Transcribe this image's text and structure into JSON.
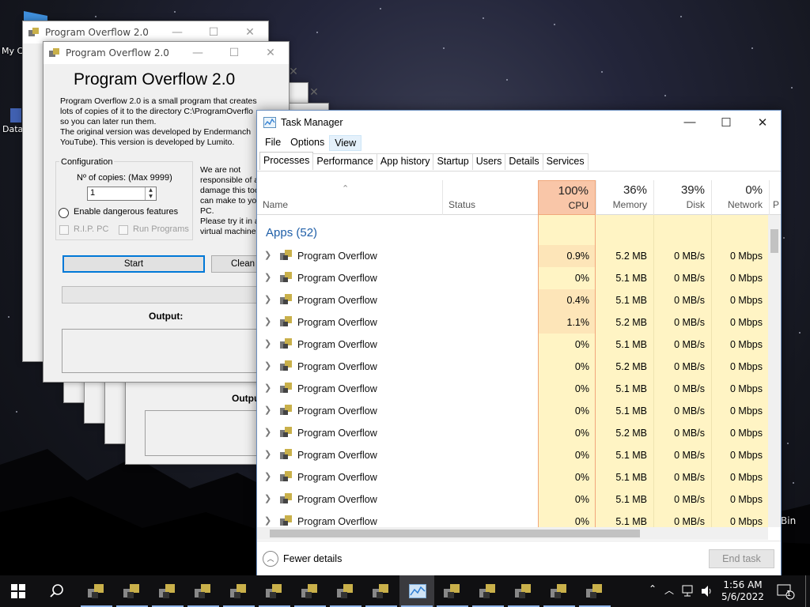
{
  "desktop": {
    "icons": [
      {
        "label": "My C"
      },
      {
        "label": "Data"
      },
      {
        "label": "Bin"
      }
    ]
  },
  "program_window": {
    "title_bar": "Program Overflow 2.0",
    "heading": "Program Overflow 2.0",
    "description": "Program Overflow 2.0 is a small program that creates lots of copies of it to the directory C:\\ProgramOverflo\nso you can later run them.\nThe original version was developed by Endermanch\nYouTube). This version is developed by Lumito.",
    "configuration_label": "Configuration",
    "copies_label": "Nº of copies: (Max 9999)",
    "copies_value": "1",
    "dangerous_label": "Enable dangerous features",
    "rip_pc_label": "R.I.P. PC",
    "run_programs_label": "Run Programs",
    "warning": "We are not\nresponsible of a\ndamage this too\ncan make to yo\nPC.\nPlease try it in a\nvirtual machine",
    "start_label": "Start",
    "clean_label": "Clean",
    "output_label": "Output:",
    "back_output_label": "Outpu"
  },
  "task_manager": {
    "title": "Task Manager",
    "menu": [
      "File",
      "Options",
      "View"
    ],
    "tabs": [
      "Processes",
      "Performance",
      "App history",
      "Startup",
      "Users",
      "Details",
      "Services"
    ],
    "columns": {
      "name": "Name",
      "status": "Status",
      "cpu": {
        "pct": "100%",
        "label": "CPU"
      },
      "memory": {
        "pct": "36%",
        "label": "Memory"
      },
      "disk": {
        "pct": "39%",
        "label": "Disk"
      },
      "network": {
        "pct": "0%",
        "label": "Network"
      },
      "power": "P"
    },
    "group_label": "Apps (52)",
    "rows": [
      {
        "name": "Program Overflow",
        "cpu": "0.9%",
        "memory": "5.2 MB",
        "disk": "0 MB/s",
        "network": "0 Mbps"
      },
      {
        "name": "Program Overflow",
        "cpu": "0%",
        "memory": "5.1 MB",
        "disk": "0 MB/s",
        "network": "0 Mbps"
      },
      {
        "name": "Program Overflow",
        "cpu": "0.4%",
        "memory": "5.1 MB",
        "disk": "0 MB/s",
        "network": "0 Mbps"
      },
      {
        "name": "Program Overflow",
        "cpu": "1.1%",
        "memory": "5.2 MB",
        "disk": "0 MB/s",
        "network": "0 Mbps"
      },
      {
        "name": "Program Overflow",
        "cpu": "0%",
        "memory": "5.1 MB",
        "disk": "0 MB/s",
        "network": "0 Mbps"
      },
      {
        "name": "Program Overflow",
        "cpu": "0%",
        "memory": "5.2 MB",
        "disk": "0 MB/s",
        "network": "0 Mbps"
      },
      {
        "name": "Program Overflow",
        "cpu": "0%",
        "memory": "5.1 MB",
        "disk": "0 MB/s",
        "network": "0 Mbps"
      },
      {
        "name": "Program Overflow",
        "cpu": "0%",
        "memory": "5.1 MB",
        "disk": "0 MB/s",
        "network": "0 Mbps"
      },
      {
        "name": "Program Overflow",
        "cpu": "0%",
        "memory": "5.2 MB",
        "disk": "0 MB/s",
        "network": "0 Mbps"
      },
      {
        "name": "Program Overflow",
        "cpu": "0%",
        "memory": "5.1 MB",
        "disk": "0 MB/s",
        "network": "0 Mbps"
      },
      {
        "name": "Program Overflow",
        "cpu": "0%",
        "memory": "5.1 MB",
        "disk": "0 MB/s",
        "network": "0 Mbps"
      },
      {
        "name": "Program Overflow",
        "cpu": "0%",
        "memory": "5.1 MB",
        "disk": "0 MB/s",
        "network": "0 Mbps"
      },
      {
        "name": "Program Overflow",
        "cpu": "0%",
        "memory": "5.1 MB",
        "disk": "0 MB/s",
        "network": "0 Mbps"
      }
    ],
    "fewer_details": "Fewer details",
    "end_task": "End task"
  },
  "taskbar": {
    "time": "1:56 AM",
    "date": "5/6/2022",
    "notification_count": "1",
    "app_icon_count": 15
  },
  "colors": {
    "cpu_header": "#f9c6a8",
    "cpu_cell_strong": "#fde5b8",
    "cpu_cell": "#fff4c4",
    "accent": "#0078d7",
    "group_text": "#1f5fa8"
  }
}
